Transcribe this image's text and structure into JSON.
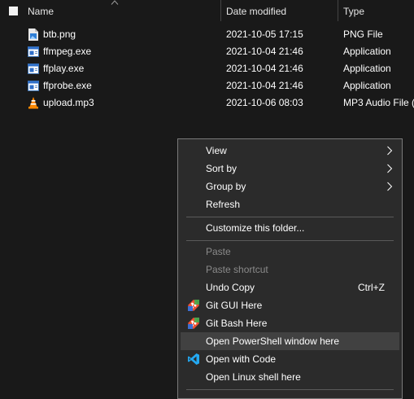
{
  "header": {
    "name": "Name",
    "date": "Date modified",
    "type": "Type"
  },
  "files": [
    {
      "name": "btb.png",
      "date": "2021-10-05 17:15",
      "type": "PNG File",
      "icon": "image-file-icon"
    },
    {
      "name": "ffmpeg.exe",
      "date": "2021-10-04 21:46",
      "type": "Application",
      "icon": "application-icon"
    },
    {
      "name": "ffplay.exe",
      "date": "2021-10-04 21:46",
      "type": "Application",
      "icon": "application-icon"
    },
    {
      "name": "ffprobe.exe",
      "date": "2021-10-04 21:46",
      "type": "Application",
      "icon": "application-icon"
    },
    {
      "name": "upload.mp3",
      "date": "2021-10-06 08:03",
      "type": "MP3 Audio File (",
      "icon": "vlc-audio-icon"
    }
  ],
  "menu": {
    "view": "View",
    "sort_by": "Sort by",
    "group_by": "Group by",
    "refresh": "Refresh",
    "customize": "Customize this folder...",
    "paste": "Paste",
    "paste_shortcut": "Paste shortcut",
    "undo_copy": "Undo Copy",
    "undo_copy_shortcut": "Ctrl+Z",
    "git_gui": "Git GUI Here",
    "git_bash": "Git Bash Here",
    "powershell": "Open PowerShell window here",
    "open_code": "Open with Code",
    "linux_shell": "Open Linux shell here"
  },
  "colors": {
    "background": "#191919",
    "menu_background": "#2b2b2b",
    "menu_hover": "#414141",
    "disabled_text": "#8a8a8a",
    "git_orange": "#f05133",
    "vscode_blue": "#23a9f2"
  }
}
